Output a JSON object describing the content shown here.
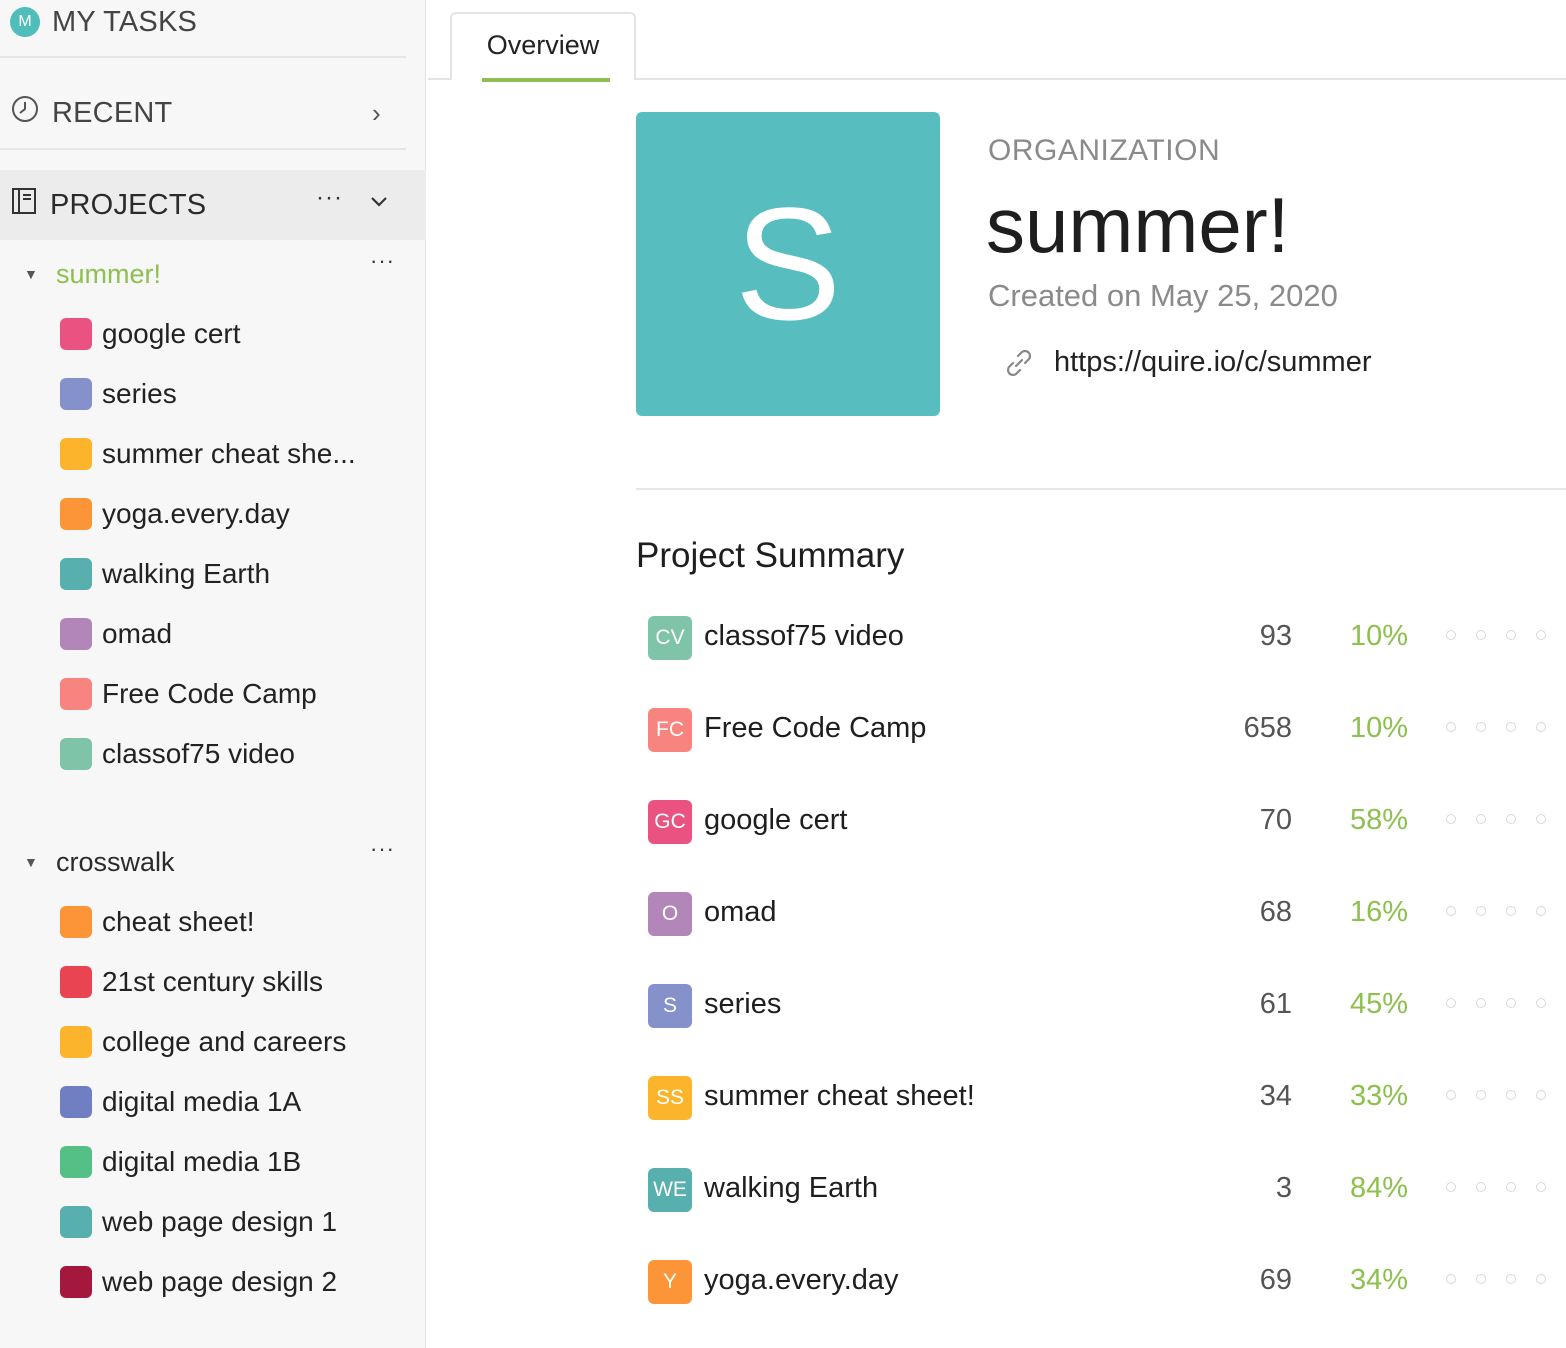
{
  "sidebar": {
    "my_tasks": {
      "avatar_letter": "M",
      "label": "MY TASKS"
    },
    "recent": {
      "label": "RECENT"
    },
    "projects": {
      "label": "PROJECTS",
      "more": "···"
    },
    "groups": [
      {
        "name": "summer!",
        "more": "···",
        "items": [
          {
            "label": "google cert",
            "color": "#ea5381"
          },
          {
            "label": "series",
            "color": "#8591ca"
          },
          {
            "label": "summer cheat she...",
            "color": "#fbb42c"
          },
          {
            "label": "yoga.every.day",
            "color": "#fc9538"
          },
          {
            "label": "walking Earth",
            "color": "#57b0ae"
          },
          {
            "label": "omad",
            "color": "#b386b9"
          },
          {
            "label": "Free Code Camp",
            "color": "#f7847f"
          },
          {
            "label": "classof75 video",
            "color": "#7fc4a9"
          }
        ]
      },
      {
        "name": "crosswalk",
        "more": "···",
        "items": [
          {
            "label": "cheat sheet!",
            "color": "#fc9538"
          },
          {
            "label": "21st century skills",
            "color": "#e84451"
          },
          {
            "label": "college and careers",
            "color": "#fbb42c"
          },
          {
            "label": "digital media 1A",
            "color": "#6f7fc2"
          },
          {
            "label": "digital media 1B",
            "color": "#54c086"
          },
          {
            "label": "web page design 1",
            "color": "#57b0ae"
          },
          {
            "label": "web page design 2",
            "color": "#a5183e"
          }
        ]
      }
    ]
  },
  "tabs": [
    {
      "label": "Overview",
      "active": true
    }
  ],
  "organization": {
    "logo_letter": "S",
    "logo_color": "#57bdbf",
    "kind": "ORGANIZATION",
    "name": "summer!",
    "created": "Created on May 25, 2020",
    "url": "https://quire.io/c/summer"
  },
  "summary": {
    "title": "Project Summary",
    "rows": [
      {
        "badge": "CV",
        "color": "#7fc4a9",
        "name": "classof75 video",
        "count": "93",
        "percent": "10%"
      },
      {
        "badge": "FC",
        "color": "#f7847f",
        "name": "Free Code Camp",
        "count": "658",
        "percent": "10%"
      },
      {
        "badge": "GC",
        "color": "#ea5381",
        "name": "google cert",
        "count": "70",
        "percent": "58%"
      },
      {
        "badge": "O",
        "color": "#b386b9",
        "name": "omad",
        "count": "68",
        "percent": "16%"
      },
      {
        "badge": "S",
        "color": "#8591ca",
        "name": "series",
        "count": "61",
        "percent": "45%"
      },
      {
        "badge": "SS",
        "color": "#fbb42c",
        "name": "summer cheat sheet!",
        "count": "34",
        "percent": "33%"
      },
      {
        "badge": "WE",
        "color": "#57b0ae",
        "name": "walking Earth",
        "count": "3",
        "percent": "84%"
      },
      {
        "badge": "Y",
        "color": "#fc9538",
        "name": "yoga.every.day",
        "count": "69",
        "percent": "34%"
      }
    ]
  },
  "accent_color": "#8dc04e"
}
